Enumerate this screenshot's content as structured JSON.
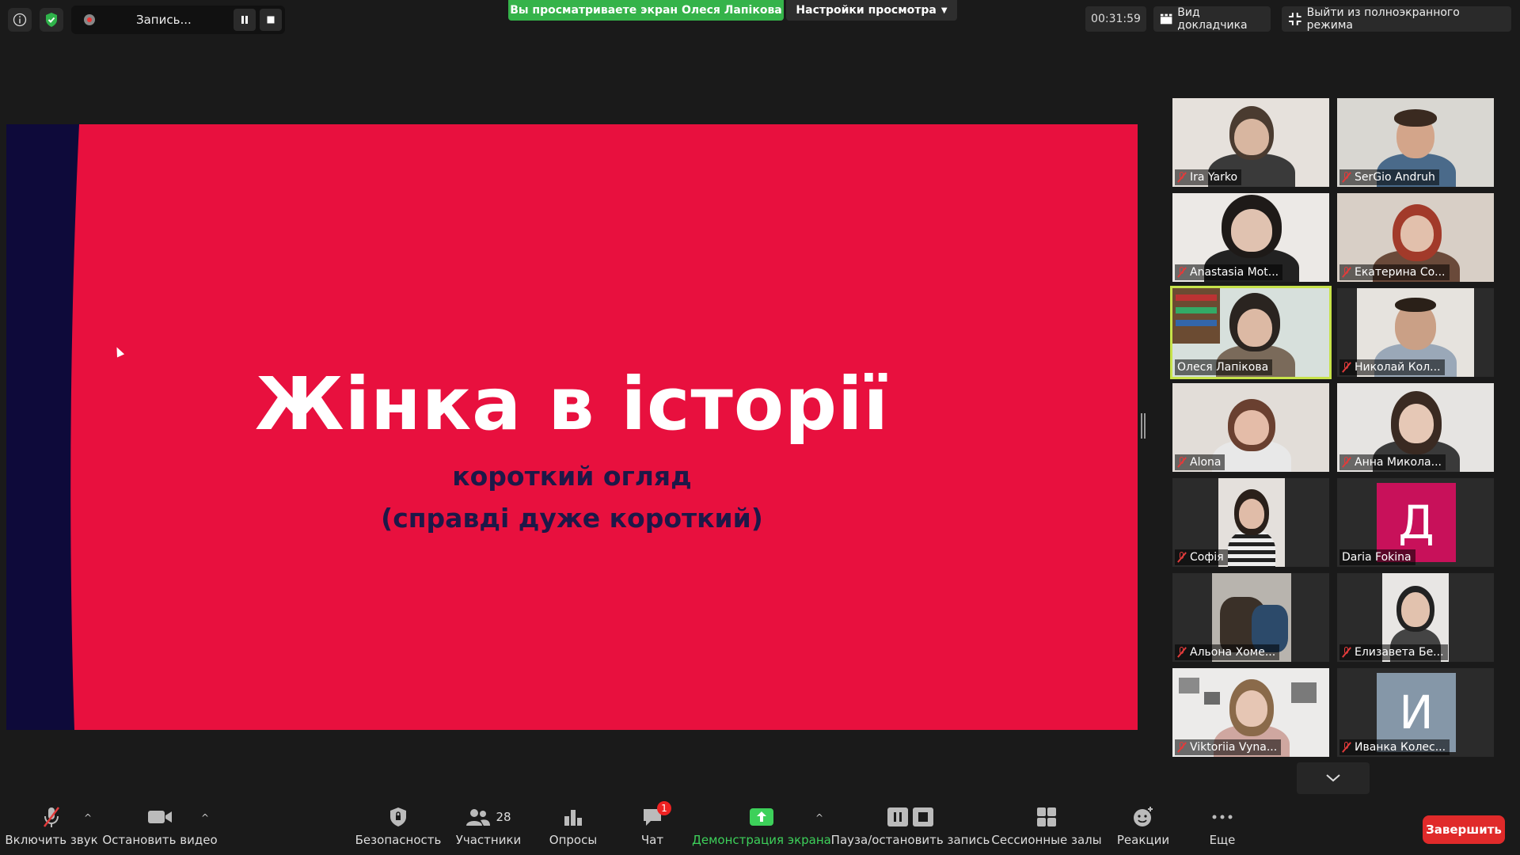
{
  "top_bar": {
    "recording_label": "Запись...",
    "share_banner": "Вы просматриваете экран Олеся Лапікова",
    "view_options": "Настройки просмотра",
    "timer": "00:31:59",
    "speaker_view": "Вид докладчика",
    "exit_fullscreen": "Выйти из полноэкранного режима"
  },
  "slide": {
    "title": "Жінка в історії",
    "subtitle_1": "короткий огляд",
    "subtitle_2": "(справді дуже короткий)",
    "colors": {
      "background": "#e8103e",
      "edge": "#0e0a3a",
      "subtitle": "#1d1848"
    }
  },
  "participants": [
    {
      "name": "Ira Yarko",
      "muted": true
    },
    {
      "name": "SerGio Andruh",
      "muted": true
    },
    {
      "name": "Anastasia Mot...",
      "muted": true
    },
    {
      "name": "Екатерина Со...",
      "muted": true
    },
    {
      "name": "Олеся Лапікова",
      "muted": false,
      "active_speaker": true
    },
    {
      "name": "Николай Кол...",
      "muted": true
    },
    {
      "name": "Alona",
      "muted": true
    },
    {
      "name": "Анна Микола...",
      "muted": true
    },
    {
      "name": "Софія",
      "muted": true
    },
    {
      "name": "Daria Fokina",
      "muted": false,
      "avatar_letter": "Д",
      "avatar_color": "#c8115a"
    },
    {
      "name": "Альона Хоме...",
      "muted": true
    },
    {
      "name": "Елизавета Бе...",
      "muted": true
    },
    {
      "name": "Viktoriia Vyna...",
      "muted": true
    },
    {
      "name": "Иванка Колес...",
      "muted": true,
      "avatar_letter": "И",
      "avatar_color": "#8597a8"
    }
  ],
  "toolbar": {
    "unmute": "Включить звук",
    "stop_video": "Остановить видео",
    "security": "Безопасность",
    "participants": "Участники",
    "participants_count": "28",
    "polls": "Опросы",
    "chat": "Чат",
    "chat_badge": "1",
    "share_screen": "Демонстрация экрана",
    "pause_record": "Пауза/остановить запись",
    "breakout": "Сессионные залы",
    "reactions": "Реакции",
    "more": "Еще",
    "end": "Завершить"
  }
}
